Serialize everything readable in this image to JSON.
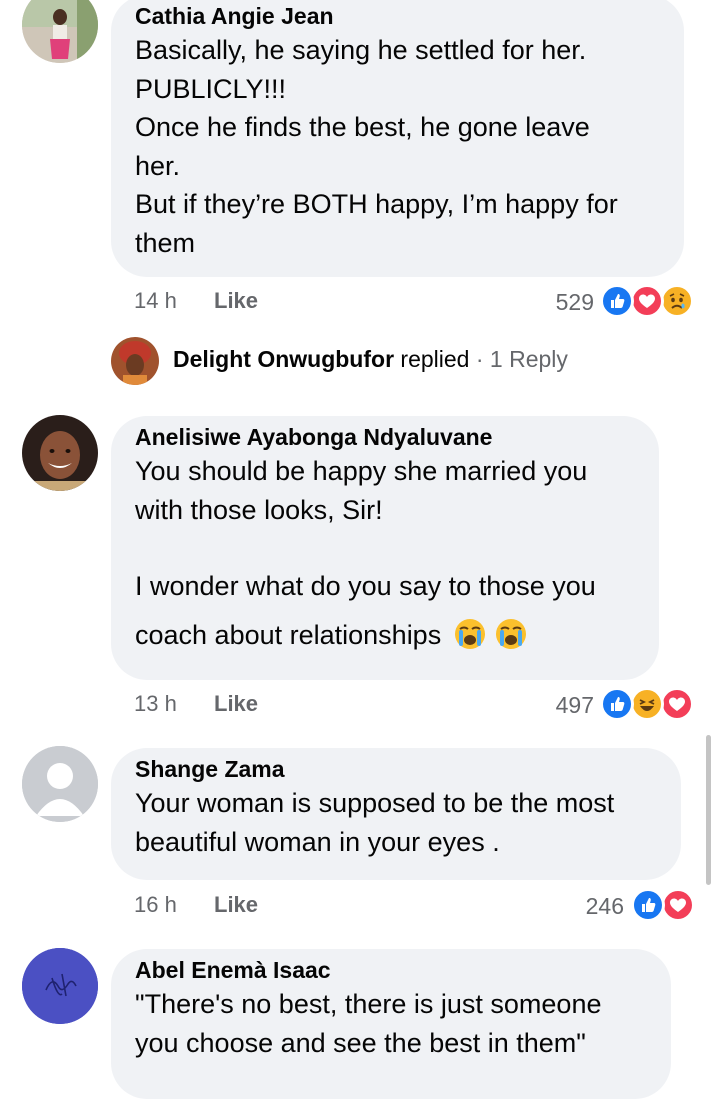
{
  "comments": [
    {
      "author": "Cathia Angie Jean",
      "lines": [
        "Basically, he saying he settled for her.",
        "PUBLICLY!!!",
        "Once he finds the best, he gone leave",
        "her.",
        "But if they’re BOTH happy, I’m happy for",
        "them"
      ],
      "time": "14 h",
      "like": "Like",
      "reaction_count": "529",
      "reactions": [
        "like-icon",
        "love-icon",
        "sad-icon"
      ]
    },
    {
      "author": "Anelisiwe Ayabonga Ndyaluvane",
      "lines": [
        "You should be happy she married you",
        "with those looks, Sir!",
        "",
        "I wonder what do you say to those you",
        "coach about relationships"
      ],
      "trailing_emoji": [
        "loudly-crying-emoji",
        "loudly-crying-emoji"
      ],
      "time": "13 h",
      "like": "Like",
      "reaction_count": "497",
      "reactions": [
        "like-icon",
        "haha-icon",
        "love-icon"
      ]
    },
    {
      "author": "Shange Zama",
      "lines": [
        "Your woman is supposed to be the most",
        "beautiful woman in your eyes ."
      ],
      "time": "16 h",
      "like": "Like",
      "reaction_count": "246",
      "reactions": [
        "like-icon",
        "love-icon"
      ]
    },
    {
      "author": "Abel Enemà Isaac",
      "lines": [
        "\"There's no best, there is just someone",
        "you choose and see the best in them\""
      ]
    }
  ],
  "reply": {
    "author": "Delight Onwugbufor",
    "action": "replied",
    "separator": "·",
    "count": "1 Reply"
  },
  "colors": {
    "bubble": "#f0f2f5",
    "muted": "#65676b",
    "like_blue": "#1877f2",
    "love_red": "#f33e58",
    "haha_yellow": "#f7b125"
  }
}
